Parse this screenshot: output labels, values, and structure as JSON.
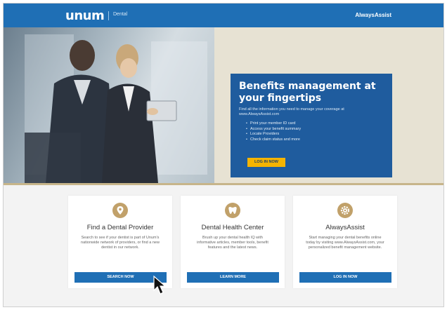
{
  "header": {
    "logo": "unum",
    "logo_sub": "Dental",
    "right_link": "AlwaysAssist"
  },
  "hero": {
    "title": "Benefits management at your fingertips",
    "intro": "Find all the information you need to manage your coverage at www.AlwaysAssist.com",
    "bullets": [
      "Print your member ID card",
      "Access your benefit summary",
      "Locate Providers",
      "Check claim status and more"
    ],
    "button": "LOG IN NOW"
  },
  "cards": [
    {
      "title": "Find a Dental Provider",
      "text": "Search to see if your dentist is part of Unum's nationwide network of providers, or find a new dentist in our network.",
      "button": "SEARCH NOW",
      "icon": "location-pin-icon"
    },
    {
      "title": "Dental Health Center",
      "text": "Brush up your dental health IQ with informative articles, member tools, benefit features and the latest news.",
      "button": "LEARN MORE",
      "icon": "tooth-icon"
    },
    {
      "title": "AlwaysAssist",
      "text": "Start managing your dental benefits online today by visiting www.AlwaysAssist.com, your personalized benefit management website.",
      "button": "LOG IN NOW",
      "icon": "gear-icon"
    }
  ],
  "colors": {
    "header_blue": "#1f6fb5",
    "promo_blue": "#1f5c9e",
    "accent_gold": "#f5b400",
    "icon_tan": "#c1a16a"
  }
}
